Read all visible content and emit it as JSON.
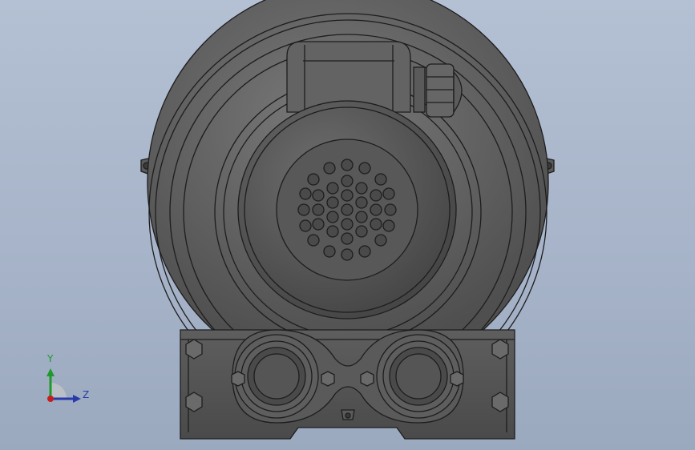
{
  "viewport": {
    "background_top": "#b4c0d3",
    "background_bottom": "#9ba9bf"
  },
  "model": {
    "name": "side-channel-blower",
    "shade": "#5f5f5f",
    "edge": "#1d1d1d"
  },
  "triad": {
    "y_label": "Y",
    "z_label": "Z",
    "y_color": "#1e9a2a",
    "z_color": "#2a3aa8",
    "x_color": "#c41e1e"
  }
}
